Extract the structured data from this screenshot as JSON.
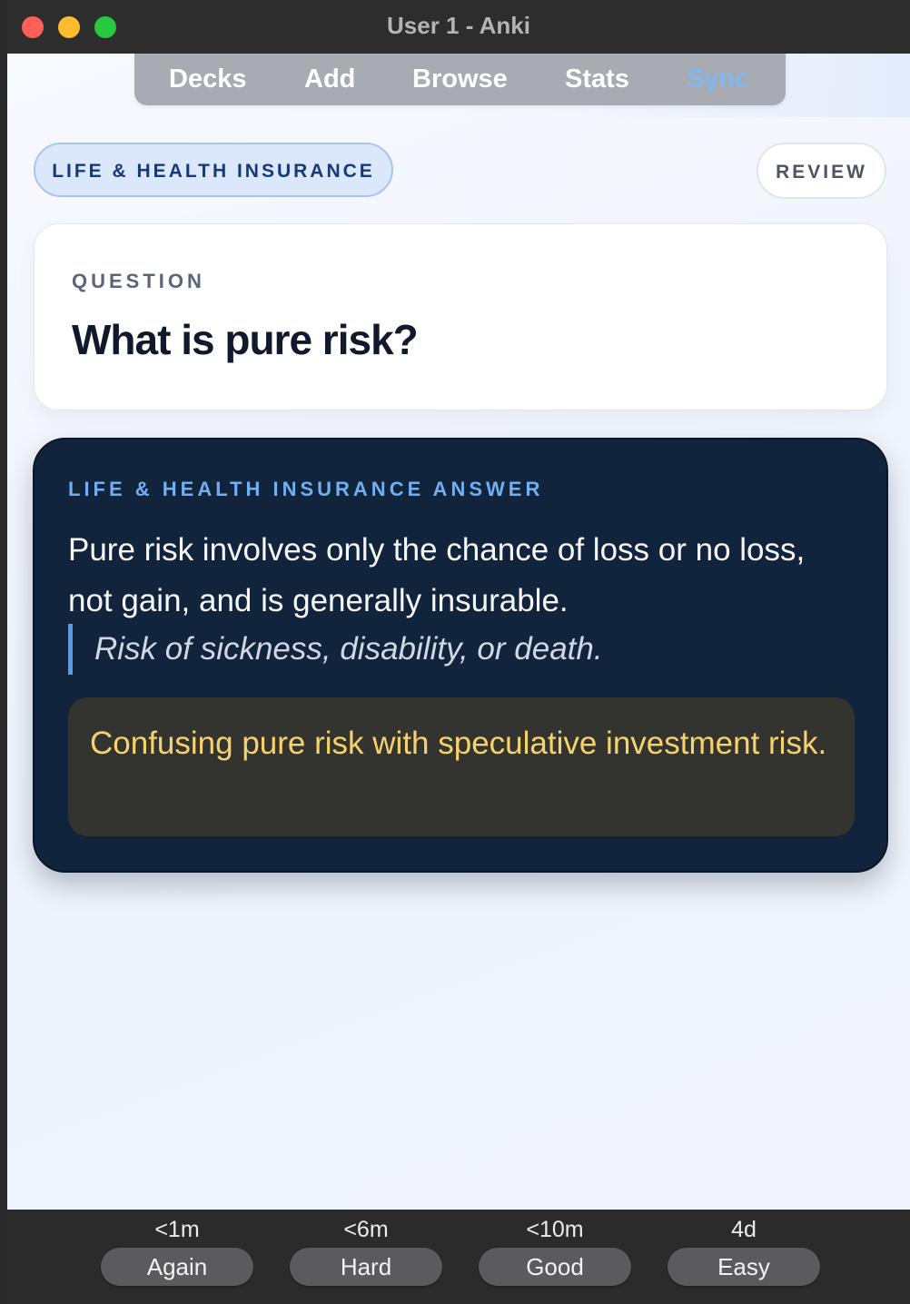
{
  "window": {
    "title": "User 1 - Anki"
  },
  "toolbar": {
    "decks": "Decks",
    "add": "Add",
    "browse": "Browse",
    "stats": "Stats",
    "sync": "Sync"
  },
  "card": {
    "deck_tag": "LIFE & HEALTH INSURANCE",
    "review_tag": "REVIEW",
    "question_label": "QUESTION",
    "question": "What is pure risk?",
    "answer_label": "LIFE & HEALTH INSURANCE ANSWER",
    "answer": "Pure risk involves only the chance of loss or no loss, not gain, and is generally insurable.",
    "example": "Risk of sickness, disability, or death.",
    "pitfall": "Confusing pure risk with speculative investment risk."
  },
  "answer_buttons": [
    {
      "label": "Again",
      "interval": "<1m"
    },
    {
      "label": "Hard",
      "interval": "<6m"
    },
    {
      "label": "Good",
      "interval": "<10m"
    },
    {
      "label": "Easy",
      "interval": "4d"
    }
  ],
  "colors": {
    "accent": "#7fb9f5",
    "answer_bg": "#12233c",
    "pitfall_text": "#f7d26b"
  }
}
